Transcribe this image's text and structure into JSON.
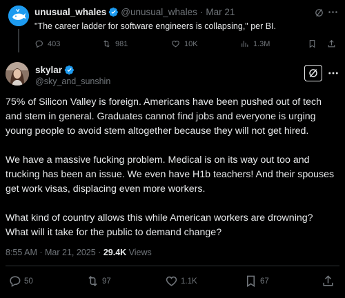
{
  "parent_post": {
    "display_name": "unusual_whales",
    "handle": "@unusual_whales",
    "separator": "·",
    "date": "Mar 21",
    "text": "\"The career ladder for software engineers is collapsing,\" per BI.",
    "avatar_icon": "whale-logo-icon",
    "actions": {
      "replies": "403",
      "reposts": "981",
      "likes": "10K",
      "views": "1.3M"
    }
  },
  "main_post": {
    "display_name": "skylar",
    "handle": "@sky_and_sunshin",
    "avatar_icon": "profile-photo",
    "paragraphs": [
      [
        "75% of Silicon Valley is foreign. Americans have been pushed out of tech",
        "and stem in general. Graduates cannot find jobs and everyone is urging",
        "young people to avoid stem altogether because they will not get hired."
      ],
      [
        "We have a massive fucking problem. Medical is on its way out too and",
        "trucking has been an issue. We even have H1b teachers! And their spouses",
        "get work visas, displacing even more workers."
      ],
      [
        "What kind of country allows this while American workers are drowning?",
        "What will it take for the public to demand change?"
      ]
    ],
    "time": "8:55 AM",
    "separator": "·",
    "date": "Mar 21, 2025",
    "views_count": "29.4K",
    "views_label": "Views",
    "actions": {
      "replies": "50",
      "reposts": "97",
      "likes": "1.1K",
      "bookmarks": "67"
    }
  },
  "colors": {
    "background": "#000000",
    "text_primary": "#e7e9ea",
    "text_secondary": "#71767b",
    "verified_badge": "#1d9bf0",
    "divider": "#2f3336"
  }
}
